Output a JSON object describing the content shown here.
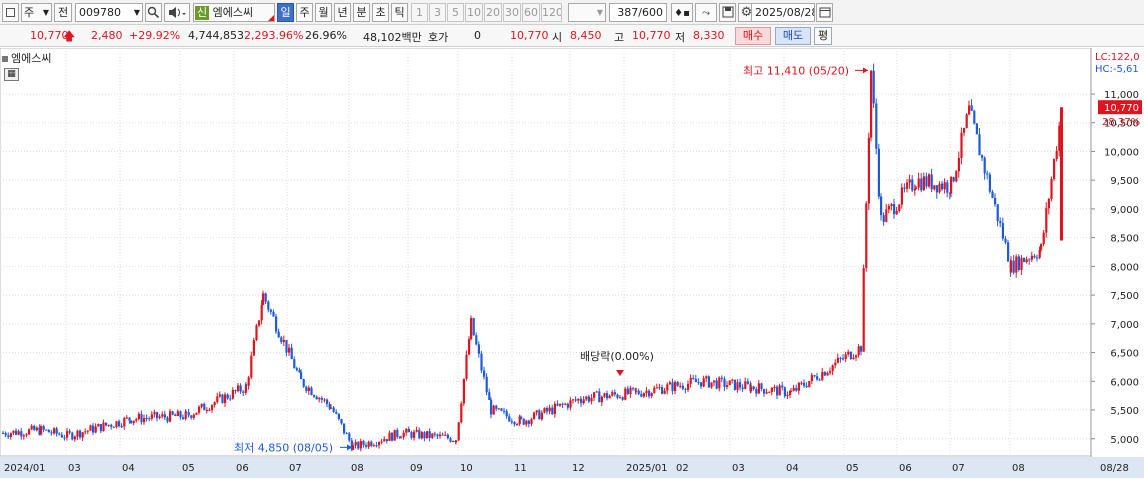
{
  "toolbar": {
    "market": "주",
    "prev_label": "전",
    "code": "009780",
    "stock_badge": "신",
    "stock_name": "엠에스씨",
    "periods": [
      {
        "label": "일",
        "active": true
      },
      {
        "label": "주",
        "active": false
      },
      {
        "label": "월",
        "active": false
      },
      {
        "label": "년",
        "active": false
      },
      {
        "label": "분",
        "active": false
      },
      {
        "label": "초",
        "active": false
      },
      {
        "label": "틱",
        "active": false
      }
    ],
    "intervals": [
      "1",
      "3",
      "5",
      "10",
      "20",
      "30",
      "60",
      "120"
    ],
    "count": "387/600",
    "date": "2025/08/28"
  },
  "quote": {
    "price": "10,770",
    "change": "2,480",
    "change_pct": "+29.92%",
    "volume": "4,744,853",
    "volume_ratio": "2,293.96%",
    "turnover": "26.96%",
    "amount": "48,102백만",
    "hoga_label": "호가",
    "hoga_value": "0",
    "ask_price": "10,770",
    "open_label": "시",
    "open_value": "8,450",
    "high_label": "고",
    "high_value": "10,770",
    "low_label": "저",
    "low_value": "8,330",
    "buy_label": "매수",
    "sell_label": "매도",
    "eval_label": "평"
  },
  "chart_title": "엠에스씨",
  "colors": {
    "up": "#e0141e",
    "down": "#1e5adc",
    "active": "#3c6fc8"
  },
  "chart_data": {
    "type": "candlestick",
    "y_ticks": [
      5000,
      5500,
      6000,
      6500,
      7000,
      7500,
      8000,
      8500,
      9000,
      9500,
      10000,
      10500,
      11000
    ],
    "ylim": [
      4700,
      11800
    ],
    "x_labels": [
      "2024/01",
      "03",
      "04",
      "05",
      "06",
      "07",
      "08",
      "09",
      "10",
      "11",
      "12",
      "2025/01",
      "02",
      "03",
      "04",
      "05",
      "06",
      "07",
      "08",
      "08/28"
    ],
    "lc_label": "LC:122,0",
    "hc_label": "HC:-5,61",
    "last_price": "10,770",
    "last_pct": "28.37%",
    "annotations": {
      "high": "최고 11,410 (05/20)",
      "low": "최저 4,850 (08/05)",
      "dividend": "배당락(0.00%)"
    },
    "close_series": [
      {
        "date": "2024/01",
        "value": 5100
      },
      {
        "date": "2024/02",
        "value": 5150
      },
      {
        "date": "2024/03",
        "value": 5050
      },
      {
        "date": "2024/04",
        "value": 5350
      },
      {
        "date": "2024/05",
        "value": 5400
      },
      {
        "date": "2024/06",
        "value": 5900
      },
      {
        "date": "2024/06",
        "value": 7500
      },
      {
        "date": "2024/07",
        "value": 6000
      },
      {
        "date": "2024/08",
        "value": 5550
      },
      {
        "date": "2024/08/05",
        "value": 4850
      },
      {
        "date": "2024/09",
        "value": 5100
      },
      {
        "date": "2024/10",
        "value": 5000
      },
      {
        "date": "2024/10",
        "value": 7000
      },
      {
        "date": "2024/10",
        "value": 5500
      },
      {
        "date": "2024/11",
        "value": 5300
      },
      {
        "date": "2024/12",
        "value": 5700
      },
      {
        "date": "2025/01",
        "value": 5800
      },
      {
        "date": "2025/02",
        "value": 6000
      },
      {
        "date": "2025/03",
        "value": 5900
      },
      {
        "date": "2025/04",
        "value": 5800
      },
      {
        "date": "2025/05",
        "value": 6600
      },
      {
        "date": "2025/05/20",
        "value": 11410
      },
      {
        "date": "2025/06",
        "value": 8800
      },
      {
        "date": "2025/06",
        "value": 9500
      },
      {
        "date": "2025/07",
        "value": 9400
      },
      {
        "date": "2025/07",
        "value": 10700
      },
      {
        "date": "2025/08",
        "value": 8000
      },
      {
        "date": "2025/08",
        "value": 8300
      },
      {
        "date": "2025/08/28",
        "value": 10770
      }
    ]
  }
}
